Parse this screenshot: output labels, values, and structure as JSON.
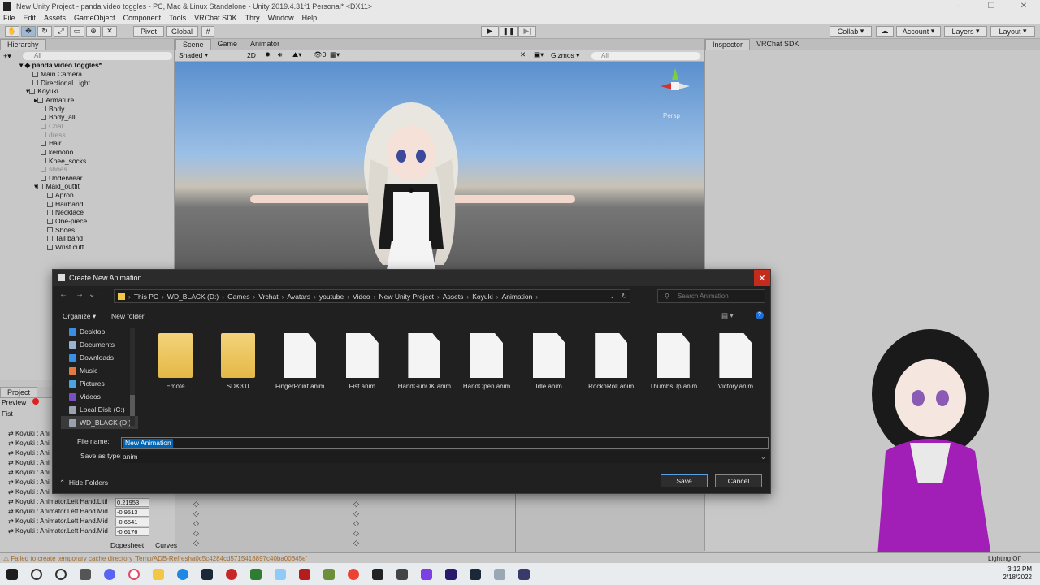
{
  "window": {
    "title": "New Unity Project - panda video toggles - PC, Mac & Linux Standalone - Unity 2019.4.31f1 Personal* <DX11>"
  },
  "menu": [
    "File",
    "Edit",
    "Assets",
    "GameObject",
    "Component",
    "Tools",
    "VRChat SDK",
    "Thry",
    "Window",
    "Help"
  ],
  "toolbar": {
    "pivot": "Pivot",
    "global": "Global",
    "collab": "Collab",
    "account": "Account",
    "layers": "Layers",
    "layout": "Layout"
  },
  "hierarchy": {
    "tab": "Hierarchy",
    "search_placeholder": "All",
    "scene_name": "panda video toggles*",
    "items": [
      {
        "label": "Main Camera",
        "dim": false
      },
      {
        "label": "Directional Light",
        "dim": false
      },
      {
        "label": "Koyuki",
        "dim": false
      },
      {
        "label": "Armature",
        "dim": false
      },
      {
        "label": "Body",
        "dim": false
      },
      {
        "label": "Body_all",
        "dim": false
      },
      {
        "label": "Coat",
        "dim": true
      },
      {
        "label": "dress",
        "dim": true
      },
      {
        "label": "Hair",
        "dim": false
      },
      {
        "label": "kemono",
        "dim": false
      },
      {
        "label": "Knee_socks",
        "dim": false
      },
      {
        "label": "shoes",
        "dim": true
      },
      {
        "label": "Underwear",
        "dim": false
      },
      {
        "label": "Maid_outfit",
        "dim": false
      },
      {
        "label": "Apron",
        "dim": false
      },
      {
        "label": "Hairband",
        "dim": false
      },
      {
        "label": "Necklace",
        "dim": false
      },
      {
        "label": "One-piece",
        "dim": false
      },
      {
        "label": "Shoes",
        "dim": false
      },
      {
        "label": "Tail band",
        "dim": false
      },
      {
        "label": "Wrist cuff",
        "dim": false
      }
    ]
  },
  "scene_tabs": [
    "Scene",
    "Game",
    "Animator"
  ],
  "scene": {
    "shading": "Shaded",
    "mode2d": "2D",
    "gizmos": "Gizmos",
    "search_placeholder": "All",
    "persp": "Persp"
  },
  "inspector_tabs": [
    "Inspector",
    "VRChat SDK"
  ],
  "project": {
    "tabs": [
      "Project"
    ],
    "preview": "Preview",
    "clip": "Fist",
    "rows": [
      {
        "label": "Koyuki : Ani",
        "value": ""
      },
      {
        "label": "Koyuki : Ani",
        "value": ""
      },
      {
        "label": "Koyuki : Ani",
        "value": ""
      },
      {
        "label": "Koyuki : Ani",
        "value": ""
      },
      {
        "label": "Koyuki : Ani",
        "value": ""
      },
      {
        "label": "Koyuki : Ani",
        "value": ""
      },
      {
        "label": "Koyuki : Ani",
        "value": ""
      },
      {
        "label": "Koyuki : Animator.Left Hand.Littl",
        "value": "0.21953"
      },
      {
        "label": "Koyuki : Animator.Left Hand.Mid",
        "value": "-0.9513"
      },
      {
        "label": "Koyuki : Animator.Left Hand.Mid",
        "value": "-0.6541"
      },
      {
        "label": "Koyuki : Animator.Left Hand.Mid",
        "value": "-0.6176"
      }
    ],
    "bottom_tabs": [
      "Dopesheet",
      "Curves"
    ]
  },
  "status": {
    "message": "Failed to create temporary cache directory 'Temp/ADB-Refresha0c5c4284cd5715418897c40ba00645e'",
    "lighting": "Lighting Off"
  },
  "dialog": {
    "title": "Create New Animation",
    "breadcrumb": [
      "This PC",
      "WD_BLACK (D:)",
      "Games",
      "Vrchat",
      "Avatars",
      "youtube",
      "Video",
      "New Unity Project",
      "Assets",
      "Koyuki",
      "Animation"
    ],
    "search_placeholder": "Search Animation",
    "organize": "Organize",
    "new_folder": "New folder",
    "nav_items": [
      {
        "label": "Desktop",
        "color": "#3a8ee6"
      },
      {
        "label": "Documents",
        "color": "#9ab3d1"
      },
      {
        "label": "Downloads",
        "color": "#3a8ee6"
      },
      {
        "label": "Music",
        "color": "#e27a3f"
      },
      {
        "label": "Pictures",
        "color": "#4aa3df"
      },
      {
        "label": "Videos",
        "color": "#7a4fc2"
      },
      {
        "label": "Local Disk (C:)",
        "color": "#9aa3ad"
      },
      {
        "label": "WD_BLACK (D:)",
        "color": "#9aa3ad"
      }
    ],
    "files": [
      {
        "name": "Emote",
        "type": "folder"
      },
      {
        "name": "SDK3.0",
        "type": "folder"
      },
      {
        "name": "FingerPoint.anim",
        "type": "file"
      },
      {
        "name": "Fist.anim",
        "type": "file"
      },
      {
        "name": "HandGunOK.anim",
        "type": "file"
      },
      {
        "name": "HandOpen.anim",
        "type": "file"
      },
      {
        "name": "Idle.anim",
        "type": "file"
      },
      {
        "name": "RocknRoll.anim",
        "type": "file"
      },
      {
        "name": "ThumbsUp.anim",
        "type": "file"
      },
      {
        "name": "Victory.anim",
        "type": "file"
      }
    ],
    "file_name_label": "File name:",
    "file_name_value": "New Animation",
    "save_as_label": "Save as type:",
    "save_as_value": "anim",
    "hide_folders": "Hide Folders",
    "save": "Save",
    "cancel": "Cancel"
  },
  "taskbar": {
    "time": "3:12 PM",
    "date": "2/18/2022"
  }
}
